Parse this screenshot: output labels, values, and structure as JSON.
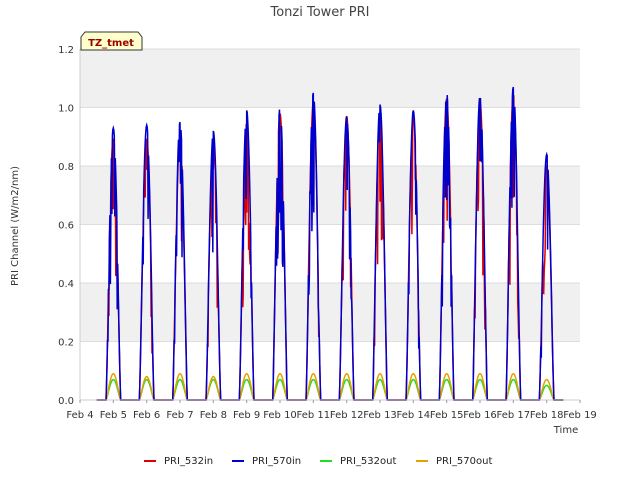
{
  "chart_data": {
    "type": "line",
    "title": "Tonzi Tower PRI",
    "xlabel": "Time",
    "ylabel": "PRI Channel (W/m2/nm)",
    "tag": "TZ_tmet",
    "xlim": [
      4,
      19
    ],
    "ylim": [
      0,
      1.2
    ],
    "x_ticks": [
      4,
      5,
      6,
      7,
      8,
      9,
      10,
      11,
      12,
      13,
      14,
      15,
      16,
      17,
      18,
      19
    ],
    "x_tick_labels": [
      "Feb 4",
      "Feb 5",
      "Feb 6",
      "Feb 7",
      "Feb 8",
      "Feb 9",
      "Feb 10",
      "Feb 11",
      "Feb 12",
      "Feb 13",
      "Feb 14",
      "Feb 15",
      "Feb 16",
      "Feb 17",
      "Feb 18",
      "Feb 19"
    ],
    "y_ticks": [
      0.0,
      0.2,
      0.4,
      0.6,
      0.8,
      1.0,
      1.2
    ],
    "y_tick_labels": [
      "0.0",
      "0.2",
      "0.4",
      "0.6",
      "0.8",
      "1.0",
      "1.2"
    ],
    "grid": true,
    "legend_placement": "bottom",
    "series": [
      {
        "name": "PRI_532in",
        "color": "#dd0000",
        "daily_peaks": [
          0.9,
          0.9,
          0.9,
          0.88,
          0.95,
          0.98,
          1.02,
          0.97,
          0.98,
          0.97,
          1.03,
          1.02,
          1.05,
          0.8
        ]
      },
      {
        "name": "PRI_570in",
        "color": "#0000cc",
        "daily_peaks": [
          0.93,
          0.94,
          0.95,
          0.92,
          0.99,
          1.0,
          1.05,
          0.97,
          1.01,
          0.99,
          1.05,
          1.04,
          1.07,
          0.84
        ]
      },
      {
        "name": "PRI_532out",
        "color": "#22dd22",
        "daily_peaks": [
          0.07,
          0.07,
          0.07,
          0.07,
          0.07,
          0.07,
          0.07,
          0.07,
          0.07,
          0.07,
          0.07,
          0.07,
          0.07,
          0.05
        ]
      },
      {
        "name": "PRI_570out",
        "color": "#e8a000",
        "daily_peaks": [
          0.09,
          0.08,
          0.09,
          0.08,
          0.09,
          0.09,
          0.09,
          0.09,
          0.09,
          0.09,
          0.09,
          0.09,
          0.09,
          0.07
        ]
      }
    ]
  }
}
